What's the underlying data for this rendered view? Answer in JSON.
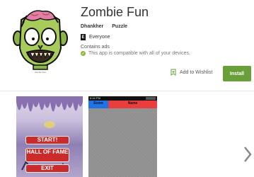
{
  "app": {
    "title": "Zombie Fun",
    "developer": "Dhankher",
    "category": "Puzzle",
    "content_rating": "Everyone",
    "rating_badge": "E",
    "contains_ads": "Contains ads",
    "compatibility": "This app is compatible with all of your devices.",
    "icon_name": "zombie-face-icon",
    "icon_caption": "Zombie Fun"
  },
  "actions": {
    "wishlist_label": "Add to Wishlist",
    "install_label": "Install"
  },
  "screenshots": {
    "menu": {
      "buttons": [
        "START!",
        "HALL OF FAME",
        "EXIT"
      ]
    },
    "leaderboard": {
      "status_time": "6:44 PM",
      "score_header": "Score",
      "name_header": "Name"
    }
  },
  "colors": {
    "install": "#689f38",
    "score_header": "#1e73e8",
    "name_header": "#ea3e3e",
    "menu_button": "#cc2b2b"
  }
}
